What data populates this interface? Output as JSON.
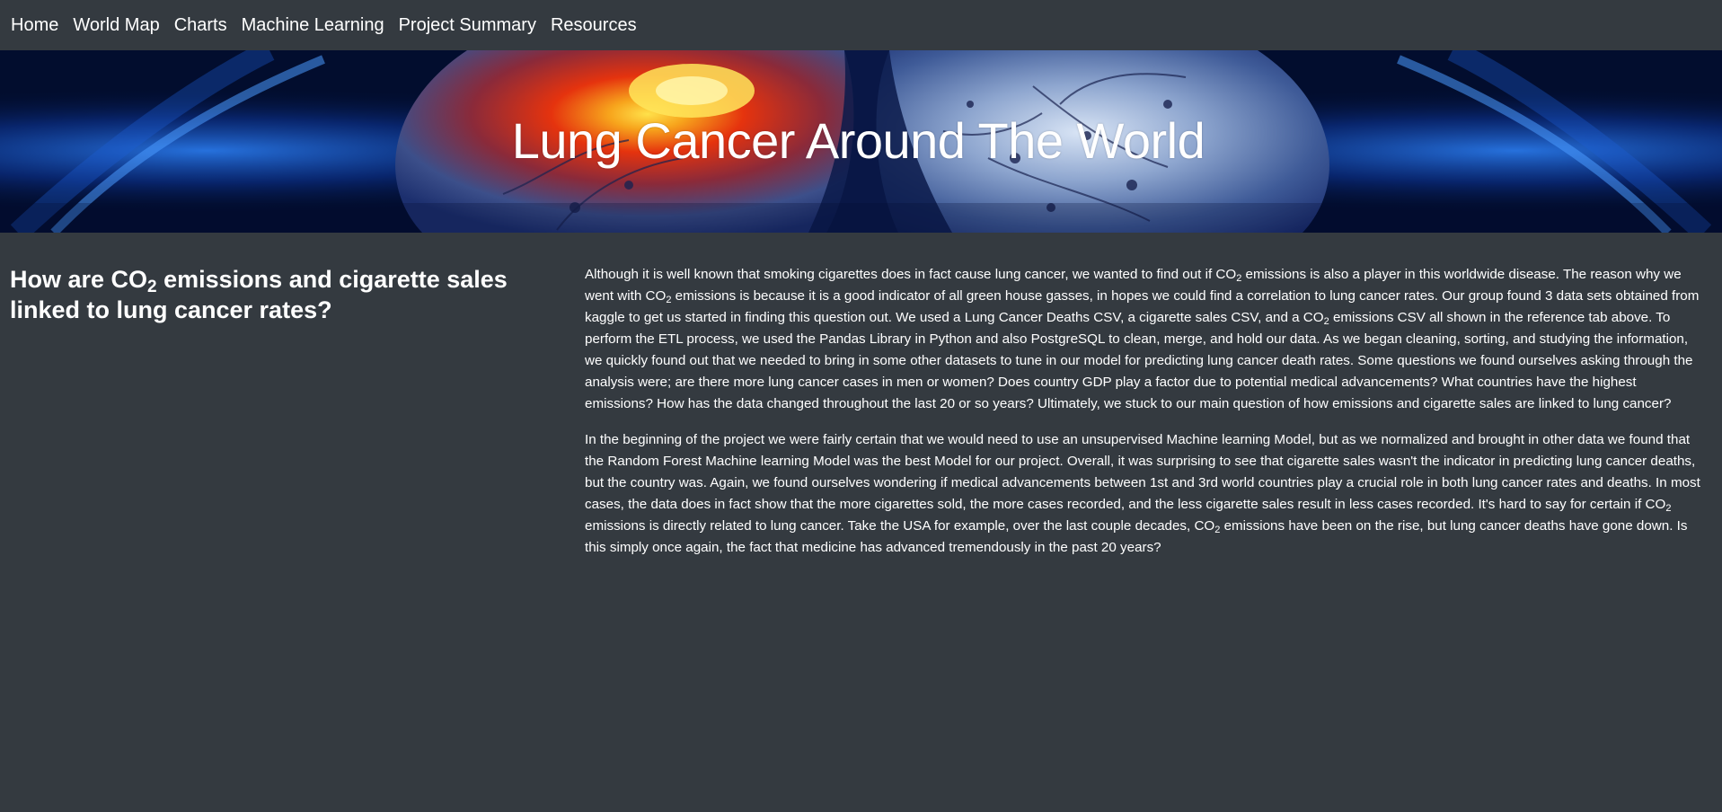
{
  "nav": {
    "items": [
      {
        "label": "Home"
      },
      {
        "label": "World Map"
      },
      {
        "label": "Charts"
      },
      {
        "label": "Machine Learning"
      },
      {
        "label": "Project Summary"
      },
      {
        "label": "Resources"
      }
    ]
  },
  "hero": {
    "title": "Lung Cancer Around The World",
    "image_subject": "glowing-lungs-illustration"
  },
  "question": {
    "part1": "How are CO",
    "sub": "2",
    "part2": " emissions and cigarette sales linked to lung cancer rates?"
  },
  "paragraph1": {
    "s1": "Although it is well known that smoking cigarettes does in fact cause lung cancer, we wanted to find out if CO",
    "s1_sub": "2",
    "s2": " emissions is also a player in this worldwide disease. The reason why we went with CO",
    "s2_sub": "2",
    "s3": " emissions is because it is a good indicator of all green house gasses, in hopes we could find a correlation to lung cancer rates. Our group found 3 data sets obtained from kaggle to get us started in finding this question out. We used a Lung Cancer Deaths CSV, a cigarette sales CSV, and a CO",
    "s3_sub": "2",
    "s4": " emissions CSV all shown in the reference tab above. To perform the ETL process, we used the Pandas Library in Python and also PostgreSQL to clean, merge, and hold our data. As we began cleaning, sorting, and studying the information, we quickly found out that we needed to bring in some other datasets to tune in our model for predicting lung cancer death rates. Some questions we found ourselves asking through the analysis were; are there more lung cancer cases in men or women? Does country GDP play a factor due to potential medical advancements? What countries have the highest emissions? How has the data changed throughout the last 20 or so years? Ultimately, we stuck to our main question of how emissions and cigarette sales are linked to lung cancer?"
  },
  "paragraph2": {
    "s1": "In the beginning of the project we were fairly certain that we would need to use an unsupervised Machine learning Model, but as we normalized and brought in other data we found that the Random Forest Machine learning Model was the best Model for our project. Overall, it was surprising to see that cigarette sales wasn't the indicator in predicting lung cancer deaths, but the country was. Again, we found ourselves wondering if medical advancements between 1st and 3rd world countries play a crucial role in both lung cancer rates and deaths. In most cases, the data does in fact show that the more cigarettes sold, the more cases recorded, and the less cigarette sales result in less cases recorded. It's hard to say for certain if CO",
    "s1_sub": "2",
    "s2": " emissions is directly related to lung cancer. Take the USA for example, over the last couple decades, CO",
    "s2_sub": "2",
    "s3": " emissions have been on the rise, but lung cancer deaths have gone down. Is this simply once again, the fact that medicine has advanced tremendously in the past 20 years?"
  },
  "colors": {
    "page_bg": "#343a40",
    "nav_bg": "#343a40",
    "text": "#ffffff",
    "hero_bg": "#020d2e",
    "hero_glow_blue": "#1f6fe0",
    "hero_tumor": "#e63a10"
  }
}
